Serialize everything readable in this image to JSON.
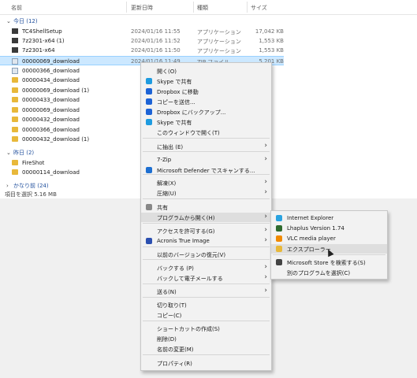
{
  "columns": {
    "name": "名前",
    "date": "更新日時",
    "type": "種類",
    "size": "サイズ"
  },
  "groups": {
    "today": "今日 (12)",
    "yesterday": "昨日 (2)",
    "earlier": "かなり前 (24)"
  },
  "files": [
    {
      "name": "TC4ShellSetup",
      "date": "2024/01/16 11:55",
      "type": "アプリケーション",
      "size": "17,042 KB",
      "icon": "app"
    },
    {
      "name": "7z2301-x64 (1)",
      "date": "2024/01/16 11:52",
      "type": "アプリケーション",
      "size": "1,553 KB",
      "icon": "app"
    },
    {
      "name": "7z2301-x64",
      "date": "2024/01/16 11:50",
      "type": "アプリケーション",
      "size": "1,553 KB",
      "icon": "app"
    },
    {
      "name": "00000069_download",
      "date": "2024/01/16 11:49",
      "type": "ZIP ファイル",
      "size": "5,201 KB",
      "icon": "doc"
    },
    {
      "name": "00000366_download",
      "date": "",
      "type": "",
      "size": "",
      "icon": "doc"
    },
    {
      "name": "00000434_download",
      "date": "",
      "type": "",
      "size": "",
      "icon": "folder"
    },
    {
      "name": "00000069_download (1)",
      "date": "",
      "type": "",
      "size": "",
      "icon": "folder"
    },
    {
      "name": "00000433_download",
      "date": "",
      "type": "",
      "size": "",
      "icon": "folder"
    },
    {
      "name": "00000069_download",
      "date": "",
      "type": "",
      "size": "",
      "icon": "folder"
    },
    {
      "name": "00000432_download",
      "date": "",
      "type": "",
      "size": "",
      "icon": "folder"
    },
    {
      "name": "00000366_download",
      "date": "",
      "type": "",
      "size": "",
      "icon": "folder"
    },
    {
      "name": "00000432_download (1)",
      "date": "",
      "type": "",
      "size": "",
      "icon": "folder"
    },
    {
      "name": "FireShot",
      "date": "",
      "type": "",
      "size": "",
      "icon": "folder"
    },
    {
      "name": "00000114_download",
      "date": "",
      "type": "",
      "size": "",
      "icon": "folder"
    }
  ],
  "status": "項目を選択  5.16 MB",
  "menu": [
    {
      "label": "開く(O)",
      "icon": "none",
      "arrow": false
    },
    {
      "label": "Skype で共有",
      "icon": "skype",
      "arrow": false
    },
    {
      "label": "Dropbox に移動",
      "icon": "dropbox",
      "arrow": false
    },
    {
      "label": "コピーを送信...",
      "icon": "dropbox",
      "arrow": false
    },
    {
      "label": "Dropbox にバックアップ...",
      "icon": "dropbox",
      "arrow": false
    },
    {
      "label": "Skype で共有",
      "icon": "skype",
      "arrow": false
    },
    {
      "label": "このウィンドウで開く(T)",
      "icon": "none",
      "arrow": false
    },
    {
      "label": "に抽出 (E)",
      "icon": "none",
      "arrow": true
    },
    {
      "label": "7-Zip",
      "icon": "none",
      "arrow": true
    },
    {
      "label": "Microsoft Defender でスキャンする...",
      "icon": "defender",
      "arrow": false
    },
    {
      "label": "解凍(X)",
      "icon": "none",
      "arrow": true
    },
    {
      "label": "圧縮(U)",
      "icon": "none",
      "arrow": true
    },
    {
      "label": "共有",
      "icon": "share",
      "arrow": false
    },
    {
      "label": "プログラムから開く(H)",
      "icon": "none",
      "arrow": true
    },
    {
      "label": "アクセスを許可する(G)",
      "icon": "none",
      "arrow": true
    },
    {
      "label": "Acronis True Image",
      "icon": "acronis",
      "arrow": true
    },
    {
      "label": "以前のバージョンの復元(V)",
      "icon": "none",
      "arrow": false
    },
    {
      "label": "バックする (P)",
      "icon": "none",
      "arrow": true
    },
    {
      "label": "バックして電子メールする",
      "icon": "none",
      "arrow": true
    },
    {
      "label": "送る(N)",
      "icon": "none",
      "arrow": true
    },
    {
      "label": "切り取り(T)",
      "icon": "none",
      "arrow": false
    },
    {
      "label": "コピー(C)",
      "icon": "none",
      "arrow": false
    },
    {
      "label": "ショートカットの作成(S)",
      "icon": "none",
      "arrow": false
    },
    {
      "label": "削除(D)",
      "icon": "none",
      "arrow": false
    },
    {
      "label": "名前の変更(M)",
      "icon": "none",
      "arrow": false
    },
    {
      "label": "プロパティ(R)",
      "icon": "none",
      "arrow": false
    }
  ],
  "submenu": [
    {
      "label": "Internet Explorer",
      "icon": "ie"
    },
    {
      "label": "Lhaplus Version 1.74",
      "icon": "lhaplus"
    },
    {
      "label": "VLC media player",
      "icon": "vlc"
    },
    {
      "label": "エクスプローラー",
      "icon": "explorer"
    },
    {
      "label": "Microsoft Store を検索する(S)",
      "icon": "store"
    },
    {
      "label": "別のプログラムを選択(C)",
      "icon": "none"
    }
  ],
  "colors": {
    "skype": "#1e9be0",
    "dropbox": "#1c63d6",
    "defender": "#1d6fd1",
    "acronis": "#2b4fb0",
    "ie": "#2aa3e0",
    "lhaplus": "#2f6b2f",
    "vlc": "#f08a00",
    "explorer": "#e8b83a",
    "store": "#444444"
  }
}
